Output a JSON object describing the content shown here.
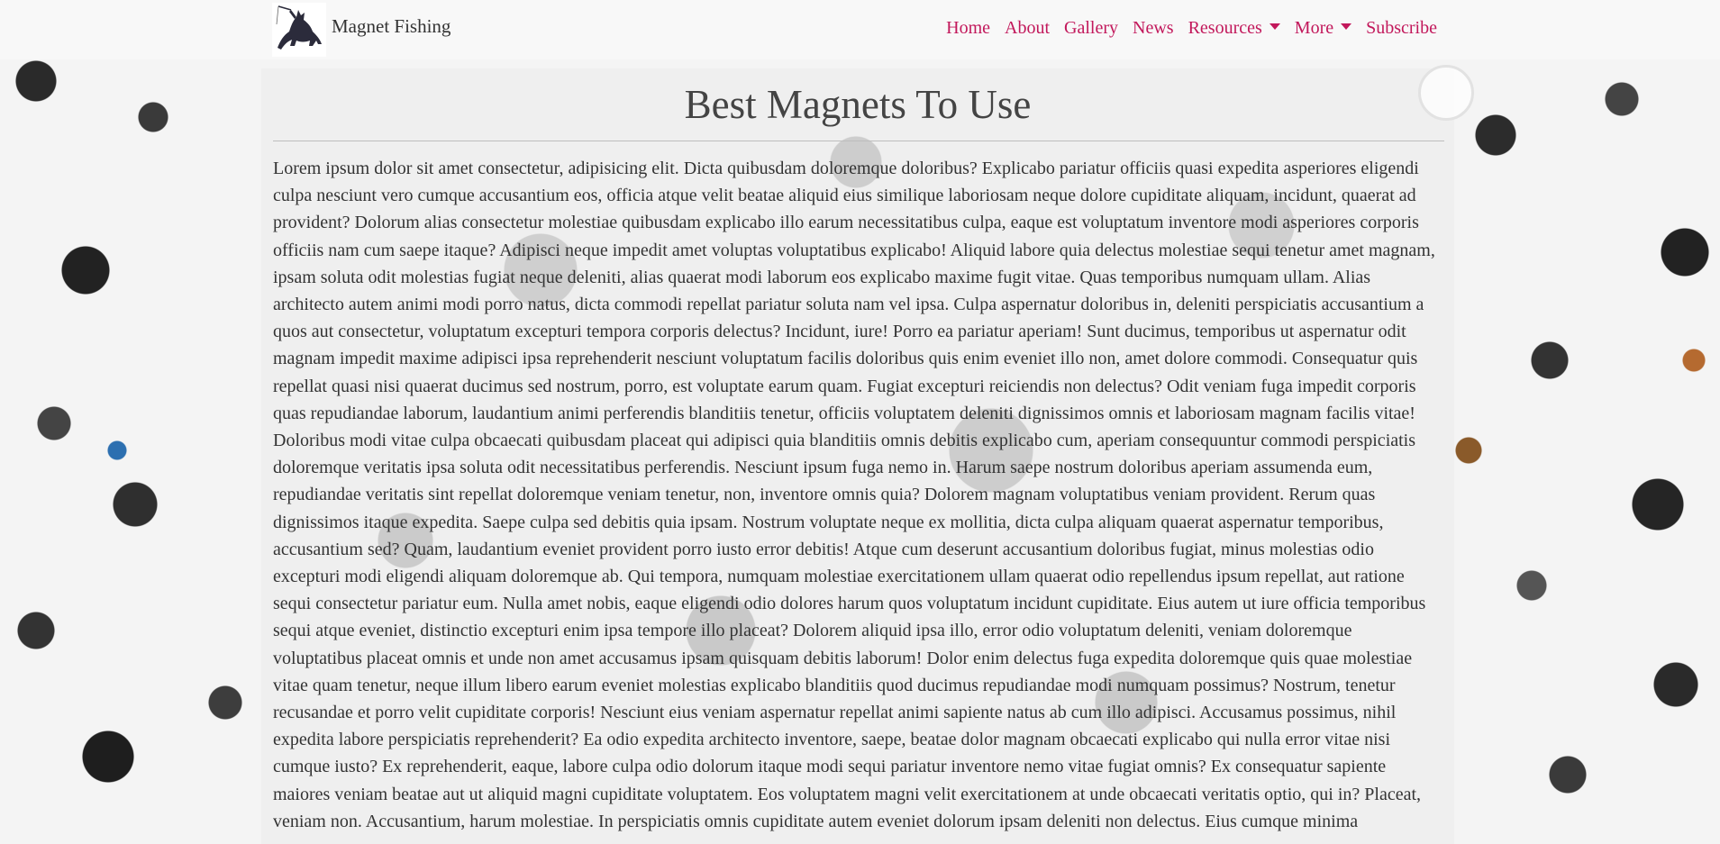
{
  "navbar": {
    "brand_name": "Magnet Fishing",
    "logo_icon": "fishing-cat-logo",
    "links": [
      {
        "label": "Home",
        "dropdown": false
      },
      {
        "label": "About",
        "dropdown": false
      },
      {
        "label": "Gallery",
        "dropdown": false
      },
      {
        "label": "News",
        "dropdown": false
      },
      {
        "label": "Resources",
        "dropdown": true
      },
      {
        "label": "More",
        "dropdown": true
      },
      {
        "label": "Subscribe",
        "dropdown": false
      }
    ]
  },
  "main": {
    "title": "Best Magnets To Use",
    "body": "Lorem ipsum dolor sit amet consectetur, adipisicing elit. Dicta quibusdam doloremque doloribus? Explicabo pariatur officiis quasi expedita asperiores eligendi culpa nesciunt vero cumque accusantium eos, officia atque velit beatae aliquid eius similique laboriosam neque dolore cupiditate aliquam, incidunt, quaerat ad provident? Dolorum alias consectetur molestiae quibusdam explicabo illo earum necessitatibus culpa, eaque est voluptatum inventore modi asperiores corporis officiis nam cum saepe itaque? Adipisci neque impedit amet voluptas voluptatibus explicabo! Aliquid labore quia delectus molestiae sequi tenetur amet magnam, ipsam soluta odit molestias fugiat neque deleniti, alias quaerat modi laborum eos explicabo maxime fugit vitae. Quas temporibus numquam ullam. Alias architecto autem animi modi porro natus, dicta commodi repellat pariatur soluta nam vel ipsa. Culpa aspernatur doloribus in, deleniti perspiciatis accusantium a quos aut consectetur, voluptatum excepturi tempora corporis delectus? Incidunt, iure! Porro ea pariatur aperiam! Sunt ducimus, temporibus ut aspernatur odit magnam impedit maxime adipisci ipsa reprehenderit nesciunt voluptatum facilis doloribus quis enim eveniet illo non, amet dolore commodi. Consequatur quis repellat quasi nisi quaerat ducimus sed nostrum, porro, est voluptate earum quam. Fugiat excepturi reiciendis non delectus? Odit veniam fuga impedit corporis quas repudiandae laborum, laudantium animi perferendis blanditiis tenetur, officiis voluptatem deleniti dignissimos omnis et laboriosam magnam facilis vitae! Doloribus modi vitae culpa obcaecati quibusdam placeat qui adipisci quia blanditiis omnis debitis explicabo cum, aperiam consequuntur commodi perspiciatis doloremque veritatis ipsa soluta odit necessitatibus perferendis. Nesciunt ipsum fuga nemo in. Harum saepe nostrum doloribus aperiam assumenda eum, repudiandae veritatis sint repellat doloremque veniam tenetur, non, inventore omnis quia? Dolorem magnam voluptatibus veniam provident. Rerum quas dignissimos itaque expedita. Saepe culpa sed debitis quia ipsam. Nostrum voluptate neque ex mollitia, dicta culpa aliquam quaerat aspernatur temporibus, accusantium sed? Quam, laudantium eveniet provident porro iusto error debitis! Atque cum deserunt accusantium doloribus fugiat, minus molestias odio excepturi modi eligendi aliquam doloremque ab. Qui tempora, numquam molestiae exercitationem ullam quaerat odio repellendus ipsum repellat, aut ratione sequi consectetur pariatur eum. Nulla amet nobis, eaque eligendi odio dolores harum quos voluptatum incidunt cupiditate. Eius autem ut iure officia temporibus sequi atque eveniet, distinctio excepturi enim ipsa tempore illo placeat? Dolorem aliquid ipsa illo, error odio voluptatum deleniti, veniam doloremque voluptatibus placeat omnis et unde non amet accusamus ipsam quisquam debitis laborum! Dolor enim delectus fuga expedita doloremque quis quae molestiae vitae quam tenetur, neque illum libero earum eveniet molestias explicabo blanditiis quod ducimus repudiandae modi numquam possimus? Nostrum, tenetur recusandae et porro velit cupiditate corporis! Nesciunt eius veniam aspernatur repellat animi sapiente natus ab cum illo adipisci. Accusamus possimus, nihil expedita labore perspiciatis reprehenderit? Ea odio expedita architecto inventore, saepe, beatae dolor magnam obcaecati explicabo qui nulla error vitae nisi cumque iusto? Ex reprehenderit, eaque, labore culpa odio dolorum itaque modi sequi pariatur inventore nemo vitae fugiat omnis? Ex consequatur sapiente maiores veniam beatae aut ut aliquid magni cupiditate voluptatem. Eos voluptatem magni velit exercitationem at unde obcaecati veritatis optio, qui in? Placeat, veniam non. Accusantium, harum molestiae. In perspiciatis omnis cupiditate autem eveniet dolorum ipsam deleniti non delectus. Eius cumque minima"
  },
  "colors": {
    "nav_link": "#c2185b",
    "navbar_bg": "#f8f8f8",
    "text": "#333333"
  }
}
